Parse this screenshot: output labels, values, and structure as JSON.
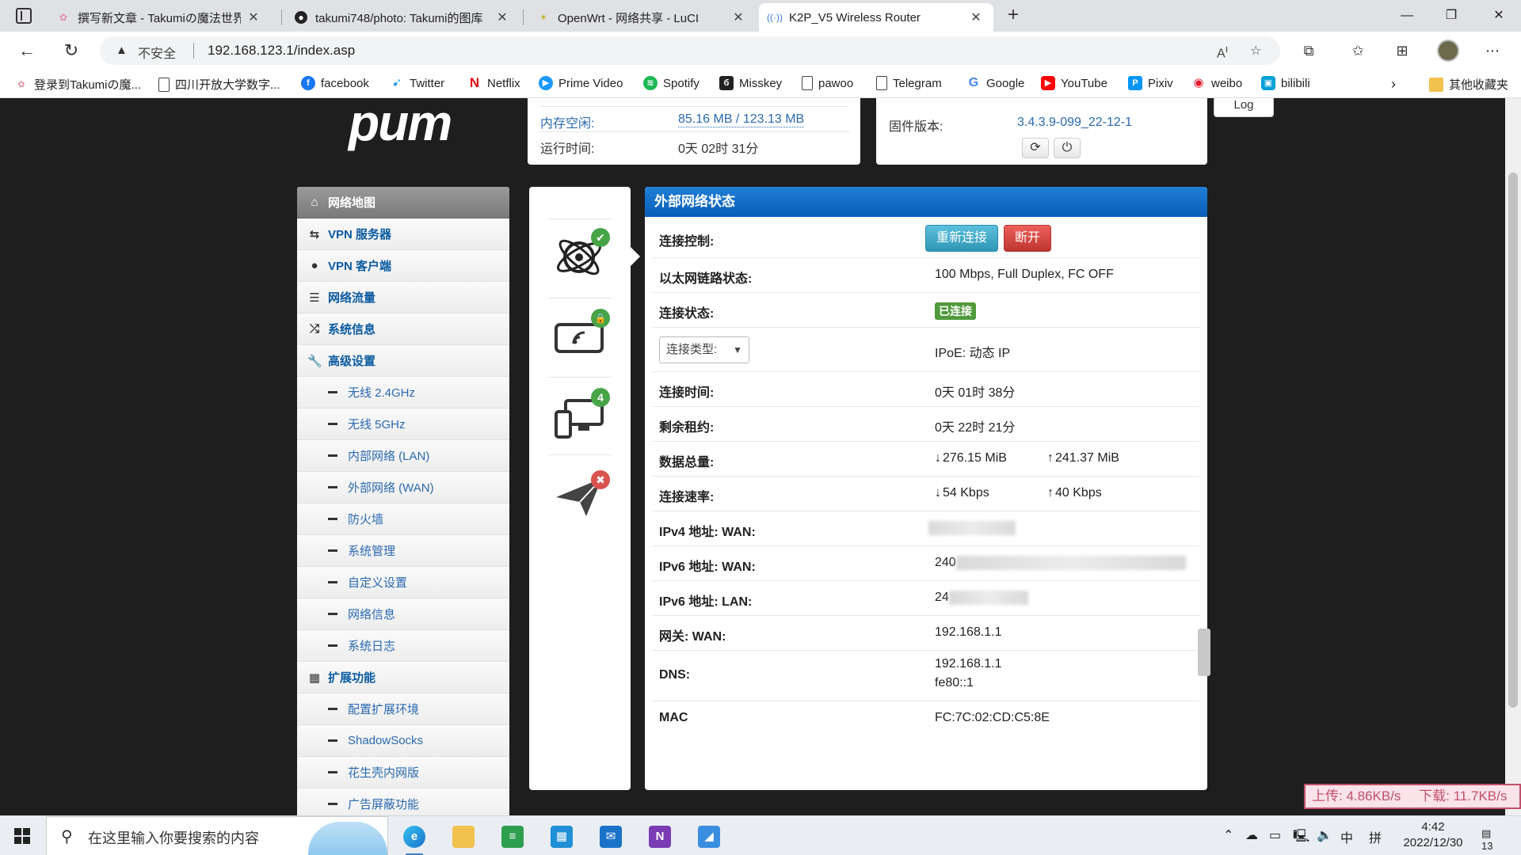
{
  "browser": {
    "tabs": [
      {
        "title": "撰写新文章 - Takumiの魔法世界",
        "icon": "pink-flower-icon",
        "close": "✕"
      },
      {
        "title": "takumi748/photo: Takumi的图库",
        "icon": "github-icon",
        "close": "✕"
      },
      {
        "title": "OpenWrt - 网络共享 - LuCI",
        "icon": "luci-icon",
        "close": "✕"
      },
      {
        "title": "K2P_V5 Wireless Router",
        "icon": "wireless-icon",
        "close": "✕"
      }
    ],
    "insecure_label": "不安全",
    "url": "192.168.123.1/index.asp",
    "bookmarks": [
      {
        "label": "登录到Takumiの魔...",
        "icon": "pink-flower-icon"
      },
      {
        "label": "四川开放大学数字...",
        "icon": "page-icon"
      },
      {
        "label": "facebook",
        "icon": "facebook-icon"
      },
      {
        "label": "Twitter",
        "icon": "twitter-icon"
      },
      {
        "label": "Netflix",
        "icon": "netflix-icon"
      },
      {
        "label": "Prime Video",
        "icon": "prime-video-icon"
      },
      {
        "label": "Spotify",
        "icon": "spotify-icon"
      },
      {
        "label": "Misskey",
        "icon": "misskey-icon"
      },
      {
        "label": "pawoo",
        "icon": "page-icon"
      },
      {
        "label": "Telegram",
        "icon": "page-icon"
      },
      {
        "label": "Google",
        "icon": "google-icon"
      },
      {
        "label": "YouTube",
        "icon": "youtube-icon"
      },
      {
        "label": "Pixiv",
        "icon": "pixiv-icon"
      },
      {
        "label": "weibo",
        "icon": "weibo-icon"
      },
      {
        "label": "bilibili",
        "icon": "bilibili-icon"
      }
    ],
    "other_bookmarks": "其他收藏夹"
  },
  "router": {
    "logo_fragment": "pum",
    "sysinfo": {
      "mem_free_label": "内存空闲:",
      "mem_free_value": "85.16 MB / 123.13 MB",
      "uptime_label": "运行时间:",
      "uptime_value": "0天 02时 31分"
    },
    "firmware": {
      "label": "固件版本:",
      "value": "3.4.3.9-099_22-12-1"
    },
    "log_button": "Log",
    "menu": [
      {
        "label": "网络地图",
        "icon": "home-icon",
        "type": "top",
        "active": true
      },
      {
        "label": "VPN 服务器",
        "icon": "retweet-icon",
        "type": "top"
      },
      {
        "label": "VPN 客户端",
        "icon": "globe-icon",
        "type": "top"
      },
      {
        "label": "网络流量",
        "icon": "list-icon",
        "type": "top"
      },
      {
        "label": "系统信息",
        "icon": "shuffle-icon",
        "type": "top"
      },
      {
        "label": "高级设置",
        "icon": "wrench-icon",
        "type": "top"
      },
      {
        "label": "无线 2.4GHz",
        "type": "sub"
      },
      {
        "label": "无线 5GHz",
        "type": "sub"
      },
      {
        "label": "内部网络 (LAN)",
        "type": "sub"
      },
      {
        "label": "外部网络 (WAN)",
        "type": "sub"
      },
      {
        "label": "防火墙",
        "type": "sub"
      },
      {
        "label": "系统管理",
        "type": "sub"
      },
      {
        "label": "自定义设置",
        "type": "sub"
      },
      {
        "label": "网络信息",
        "type": "sub"
      },
      {
        "label": "系统日志",
        "type": "sub"
      },
      {
        "label": "扩展功能",
        "icon": "grid-icon",
        "type": "top"
      },
      {
        "label": "配置扩展环境",
        "type": "sub"
      },
      {
        "label": "ShadowSocks",
        "type": "sub"
      },
      {
        "label": "花生壳内网版",
        "type": "sub"
      },
      {
        "label": "广告屏蔽功能",
        "type": "sub"
      }
    ],
    "status_icons": [
      {
        "name": "internet-globe-icon",
        "badge": "✔",
        "badge_color": "#47a447"
      },
      {
        "name": "wireless-device-icon",
        "badge": "🔒",
        "badge_color": "#47a447"
      },
      {
        "name": "clients-icon",
        "badge": "4",
        "badge_color": "#47a447"
      },
      {
        "name": "paper-plane-icon",
        "badge": "✖",
        "badge_color": "#d9534f"
      }
    ],
    "panel": {
      "title": "外部网络状态",
      "connect_control_label": "连接控制:",
      "reconnect_button": "重新连接",
      "disconnect_button": "断开",
      "ethernet_link_label": "以太网链路状态:",
      "ethernet_link_value": "100 Mbps, Full Duplex, FC OFF",
      "connection_state_label": "连接状态:",
      "connection_state_value": "已连接",
      "connection_type_select": "连接类型:",
      "connection_type_value": "IPoE: 动态 IP",
      "connect_time_label": "连接时间:",
      "connect_time_value": "0天 01时 38分",
      "lease_remaining_label": "剩余租约:",
      "lease_remaining_value": "0天 22时 21分",
      "data_total_label": "数据总量:",
      "data_down": "276.15 MiB",
      "data_up": "241.37 MiB",
      "rate_label": "连接速率:",
      "rate_down": "54 Kbps",
      "rate_up": "40 Kbps",
      "ipv4_wan_label": "IPv4 地址: WAN:",
      "ipv6_wan_label": "IPv6 地址: WAN:",
      "ipv6_wan_prefix": "240",
      "ipv6_lan_label": "IPv6 地址: LAN:",
      "ipv6_lan_prefix": "24",
      "gateway_label": "网关: WAN:",
      "gateway_value": "192.168.1.1",
      "dns_label": "DNS:",
      "dns_value_1": "192.168.1.1",
      "dns_value_2": "fe80::1",
      "mac_label": "MAC",
      "mac_value": "FC:7C:02:CD:C5:8E"
    }
  },
  "speed_overlay": {
    "upload": "上传: 4.86KB/s",
    "download": "下载: 11.7KB/s"
  },
  "taskbar": {
    "search_placeholder": "在这里输入你要搜索的内容",
    "ime_mode": "中",
    "ime_layout": "拼",
    "time": "4:42",
    "date": "2022/12/30",
    "notification_count": "13"
  }
}
